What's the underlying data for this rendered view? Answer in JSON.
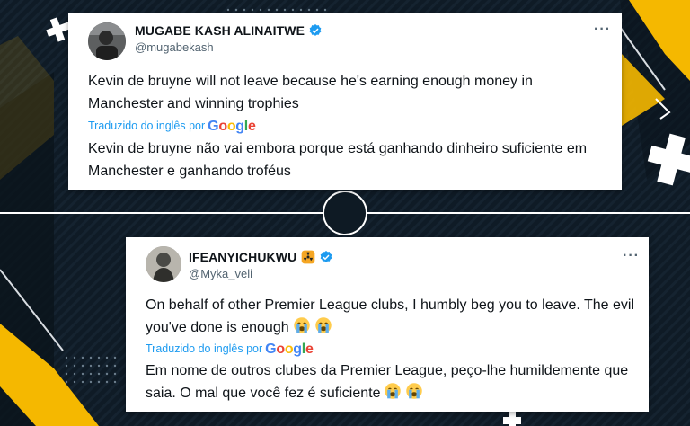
{
  "tweets": [
    {
      "display_name": "MUGABE KASH ALINAITWE",
      "handle": "@mugabekash",
      "text": "Kevin de bruyne will not leave because he's earning enough money in Manchester and winning trophies",
      "translated_label": "Traduzido do inglês por",
      "translation_provider": "Google",
      "translated_text": "Kevin de bruyne não vai embora porque está ganhando dinheiro suficiente em Manchester e ganhando troféus",
      "verified": true,
      "more_icon": "more-icon"
    },
    {
      "display_name": "IFEANYICHUKWU",
      "handle": "@Myka_veli",
      "text": "On behalf of other Premier League clubs, I humbly beg you to leave. The evil you've done is enough",
      "translated_label": "Traduzido do inglês por",
      "translation_provider": "Google",
      "translated_text": "Em nome de outros clubes da Premier League, peço-lhe humildemente que saia. O mal que você fez é suficiente",
      "verified": true,
      "name_badge_icon": "hazard-icon",
      "text_emojis": [
        "crying-face-icon",
        "crying-face-icon"
      ]
    }
  ],
  "colors": {
    "background": "#0e1a24",
    "accent_yellow": "#f5b800",
    "link_blue": "#1d9bf0",
    "verified_blue": "#1d9bf0"
  }
}
